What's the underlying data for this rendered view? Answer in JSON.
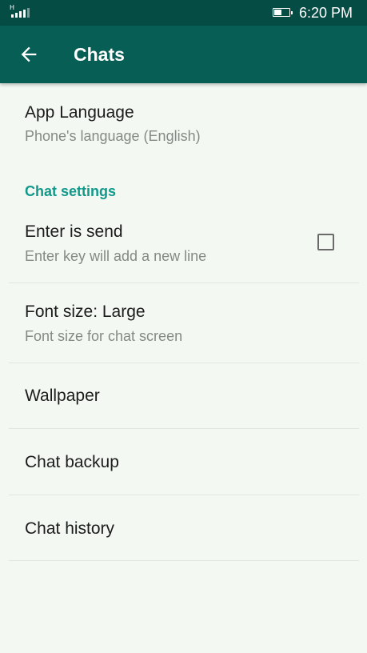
{
  "status_bar": {
    "network_label": "H",
    "time": "6:20 PM",
    "battery_level": 0.55,
    "icons": [
      "signal-icon",
      "battery-icon"
    ]
  },
  "app_bar": {
    "title": "Chats",
    "back_icon": "arrow-back-icon"
  },
  "settings": {
    "app_language": {
      "title": "App Language",
      "subtitle": "Phone's language (English)"
    },
    "section_header": "Chat settings",
    "enter_is_send": {
      "title": "Enter is send",
      "subtitle": "Enter key will add a new line",
      "checked": false
    },
    "font_size": {
      "title": "Font size: Large",
      "subtitle": "Font size for chat screen"
    },
    "wallpaper": {
      "title": "Wallpaper"
    },
    "chat_backup": {
      "title": "Chat backup"
    },
    "chat_history": {
      "title": "Chat history"
    }
  },
  "colors": {
    "status_bar": "#054d44",
    "app_bar": "#075e54",
    "accent": "#11998a",
    "background": "#f3f8f3"
  }
}
